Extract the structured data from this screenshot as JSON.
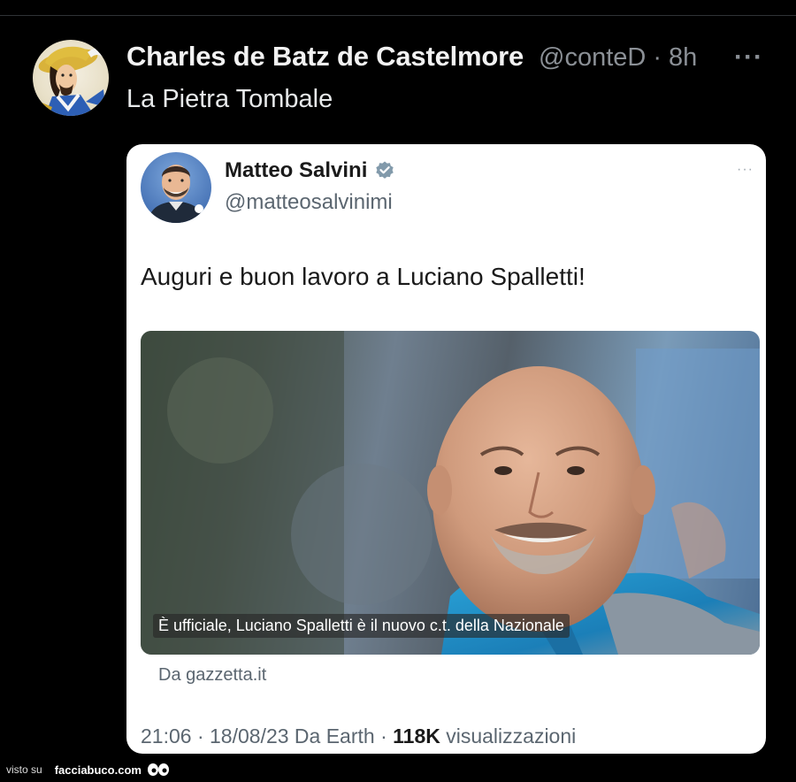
{
  "post": {
    "author_name": "Charles de Batz de Castelmore",
    "author_handle": "@conteD",
    "separator": "·",
    "time": "8h",
    "more": "···",
    "text": "La Pietra Tombale"
  },
  "quoted": {
    "name": "Matteo Salvini",
    "handle": "@matteosalvinimi",
    "more": "···",
    "text": "Auguri e buon lavoro a Luciano Spalletti!",
    "image_caption": "È ufficiale, Luciano Spalletti è il nuovo c.t. della Nazionale",
    "source": "Da gazzetta.it",
    "meta_prefix": "21:06 · 18/08/23 Da Earth · ",
    "views_count": "118K",
    "views_label": " visualizzazioni"
  },
  "watermark": {
    "prefix": "visto su",
    "brand": "facciabuco.com"
  },
  "icons": {
    "verified": "verified-badge-icon",
    "more": "more-options-icon",
    "eyes": "eyes-icon"
  },
  "colors": {
    "background": "#000000",
    "card": "#ffffff",
    "muted": "#8b9096",
    "verified": "#829aab"
  }
}
